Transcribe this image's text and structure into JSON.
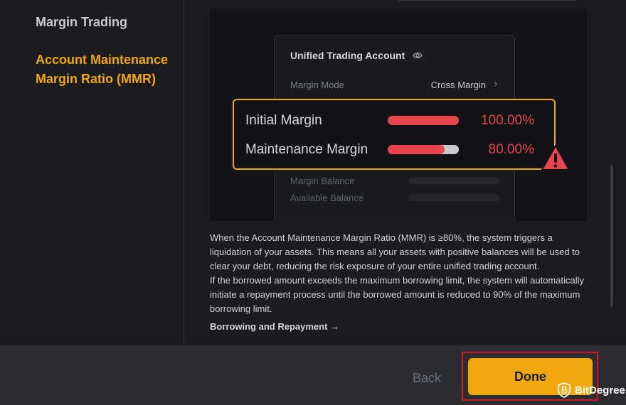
{
  "sidebar": {
    "items": [
      {
        "label": "Margin Trading"
      },
      {
        "label": "Account Maintenance Margin Ratio (MMR)"
      }
    ]
  },
  "illustration": {
    "card_title": "Unified Trading Account",
    "margin_mode_label": "Margin Mode",
    "margin_mode_value": "Cross Margin",
    "margin_balance_label": "Margin Balance",
    "available_balance_label": "Available Balance",
    "callout": {
      "initial_margin_label": "Initial Margin",
      "initial_margin_value": "100.00%",
      "initial_margin_fill": 1.0,
      "maintenance_margin_label": "Maintenance Margin",
      "maintenance_margin_value": "80.00%",
      "maintenance_margin_fill": 0.8
    }
  },
  "description": {
    "paragraph1": "When the Account Maintenance Margin Ratio (MMR) is ≥80%, the system triggers a liquidation of your assets. This means all your assets with positive balances will be used to clear your debt, reducing the risk exposure of your entire unified trading account.",
    "paragraph2": "If the borrowed amount exceeds the maximum borrowing limit, the system will automatically initiate a repayment process until the borrowed amount is reduced to 90% of the maximum borrowing limit."
  },
  "link": {
    "label": "Borrowing and Repayment →"
  },
  "footer": {
    "back_label": "Back",
    "done_label": "Done"
  },
  "watermark": {
    "text": "BitDegree"
  },
  "colors": {
    "accent": "#f0a70c",
    "danger": "#e8454e",
    "highlight": "#d01b22"
  }
}
